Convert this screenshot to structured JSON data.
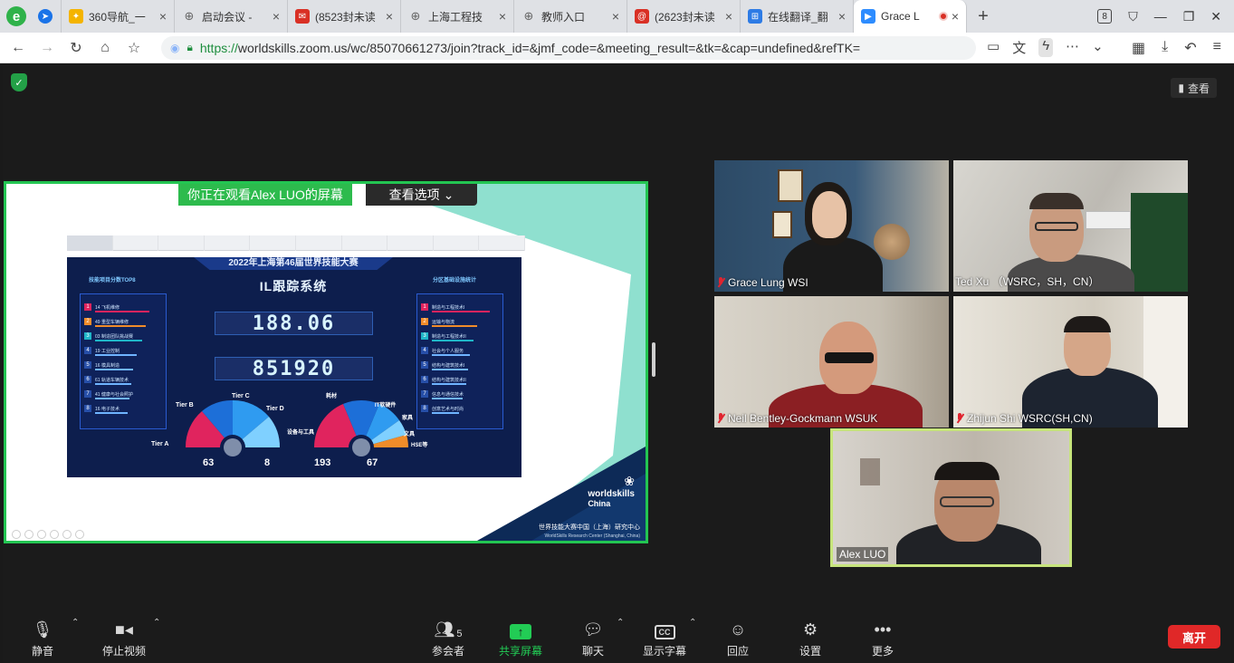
{
  "browser": {
    "tabs": [
      {
        "title": "360导航_一",
        "fav_color": "#f4b400",
        "glyph": "✦"
      },
      {
        "title": "启动会议 -",
        "fav_color": "#666666",
        "glyph": "⊕"
      },
      {
        "title": "(8523封未读",
        "fav_color": "#d93025",
        "glyph": "✉"
      },
      {
        "title": "上海工程技",
        "fav_color": "#666666",
        "glyph": "⊕"
      },
      {
        "title": "教师入口",
        "fav_color": "#666666",
        "glyph": "⊕"
      },
      {
        "title": "(2623封未读",
        "fav_color": "#d93025",
        "glyph": "@"
      },
      {
        "title": "在线翻译_翻",
        "fav_color": "#2d7be5",
        "glyph": "⊞"
      },
      {
        "title": "Grace L",
        "fav_color": "#2d8cff",
        "glyph": "▶"
      }
    ],
    "tab_count": "8",
    "url_scheme": "https://",
    "url_rest": "worldskills.zoom.us/wc/85070661273/join?track_id=&jmf_code=&meeting_result=&tk=&cap=undefined&refTK="
  },
  "zoom": {
    "view_label": "查看",
    "share_banner": "你正在观看Alex LUO的屏幕",
    "view_options": "查看选项",
    "participants": [
      {
        "name": "Grace Lung WSI",
        "muted": true
      },
      {
        "name": "Ted Xu （WSRC，SH，CN）",
        "muted": false
      },
      {
        "name": "Neil Bentley-Gockmann WSUK",
        "muted": true
      },
      {
        "name": "Zhijun Shi WSRC(SH,CN)",
        "muted": true
      }
    ],
    "active_speaker": "Alex LUO",
    "controls": {
      "mute": "静音",
      "stop_video": "停止视频",
      "participants": "参会者",
      "participant_count": "5",
      "share": "共享屏幕",
      "chat": "聊天",
      "captions": "显示字幕",
      "reactions": "回应",
      "settings": "设置",
      "more": "更多",
      "leave": "离开"
    }
  },
  "dashboard": {
    "title": "2022年上海第46届世界技能大赛",
    "subtitle": "IL跟踪系统",
    "left_panel_title": "技能项目分数TOP8",
    "right_panel_title": "分区基础设施统计",
    "left_items": [
      {
        "n": "1",
        "label": "14 飞机维修",
        "color": "#e0245e"
      },
      {
        "n": "2",
        "label": "49 重型车辆维修",
        "color": "#f08c2a"
      },
      {
        "n": "3",
        "label": "03 制造团队挑战赛",
        "color": "#1fb6c8"
      },
      {
        "n": "4",
        "label": "19 工业控制",
        "color": "#3a6fd0"
      },
      {
        "n": "5",
        "label": "16 模具制造",
        "color": "#3a6fd0"
      },
      {
        "n": "6",
        "label": "61 轨道车辆技术",
        "color": "#3a6fd0"
      },
      {
        "n": "7",
        "label": "41 健康与社会照护",
        "color": "#3a6fd0"
      },
      {
        "n": "8",
        "label": "16 电子技术",
        "color": "#3a6fd0"
      }
    ],
    "right_items": [
      {
        "n": "1",
        "label": "制造与工程技术I",
        "color": "#e0245e"
      },
      {
        "n": "2",
        "label": "运输与物流",
        "color": "#f08c2a"
      },
      {
        "n": "3",
        "label": "制造与工程技术II",
        "color": "#1fb6c8"
      },
      {
        "n": "4",
        "label": "社会与个人服务",
        "color": "#3a6fd0"
      },
      {
        "n": "5",
        "label": "结构与建筑技术I",
        "color": "#3a6fd0"
      },
      {
        "n": "6",
        "label": "结构与建筑技术II",
        "color": "#3a6fd0"
      },
      {
        "n": "7",
        "label": "信息与通信技术",
        "color": "#3a6fd0"
      },
      {
        "n": "8",
        "label": "创意艺术与时尚",
        "color": "#3a6fd0"
      }
    ],
    "counter1": "188.06",
    "counter2": "851920",
    "tiers": [
      "Tier A",
      "Tier B",
      "Tier C",
      "Tier D"
    ],
    "categories": [
      "设备与工具",
      "耗材",
      "IT软硬件",
      "家具",
      "文具",
      "HSE等"
    ],
    "stats": [
      "63",
      "8",
      "193",
      "67"
    ],
    "logo_name": "worldskills",
    "logo_sub": "China",
    "org_cn": "世界技能大赛中国（上海）研究中心",
    "org_en": "WorldSkills Research Center (Shanghai, China)"
  }
}
